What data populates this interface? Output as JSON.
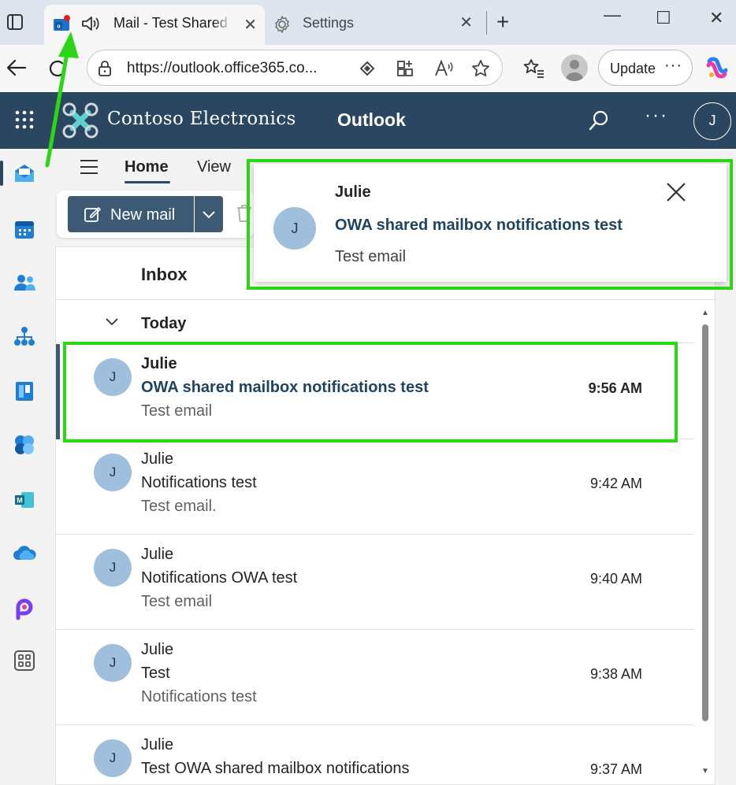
{
  "browser": {
    "active_tab_title": "Mail - Test Shared Mailbox",
    "second_tab_title": "Settings",
    "url": "https://outlook.office365.co...",
    "update_label": "Update",
    "more_label": "···"
  },
  "header": {
    "brand": "Contoso Electronics",
    "app": "Outlook",
    "more": "···",
    "avatar_initial": "J"
  },
  "toolbar": {
    "home": "Home",
    "view": "View",
    "new_mail": "New mail"
  },
  "list": {
    "folder": "Inbox",
    "group": "Today",
    "messages": [
      {
        "initial": "J",
        "sender": "Julie",
        "subject": "OWA shared mailbox notifications test",
        "preview": "Test email",
        "time": "9:56 AM",
        "unread": true
      },
      {
        "initial": "J",
        "sender": "Julie",
        "subject": "Notifications test",
        "preview": "Test email.",
        "time": "9:42 AM",
        "unread": false
      },
      {
        "initial": "J",
        "sender": "Julie",
        "subject": "Notifications OWA test",
        "preview": "Test email",
        "time": "9:40 AM",
        "unread": false
      },
      {
        "initial": "J",
        "sender": "Julie",
        "subject": "Test",
        "preview": "Notifications test",
        "time": "9:38 AM",
        "unread": false
      },
      {
        "initial": "J",
        "sender": "Julie",
        "subject": "Test OWA shared mailbox notifications",
        "preview": "",
        "time": "9:37 AM",
        "unread": false
      }
    ]
  },
  "toast": {
    "initial": "J",
    "sender": "Julie",
    "subject": "OWA shared mailbox notifications test",
    "preview": "Test email"
  },
  "colors": {
    "header_bg": "#2a4660",
    "accent": "#3d5a75",
    "annotation_green": "#2bd614"
  },
  "icons": {
    "rail": [
      "mail-icon",
      "calendar-icon",
      "people-icon",
      "org-icon",
      "files-icon",
      "teams-icon",
      "word-icon",
      "onedrive-icon",
      "loop-icon",
      "more-apps-icon"
    ]
  }
}
